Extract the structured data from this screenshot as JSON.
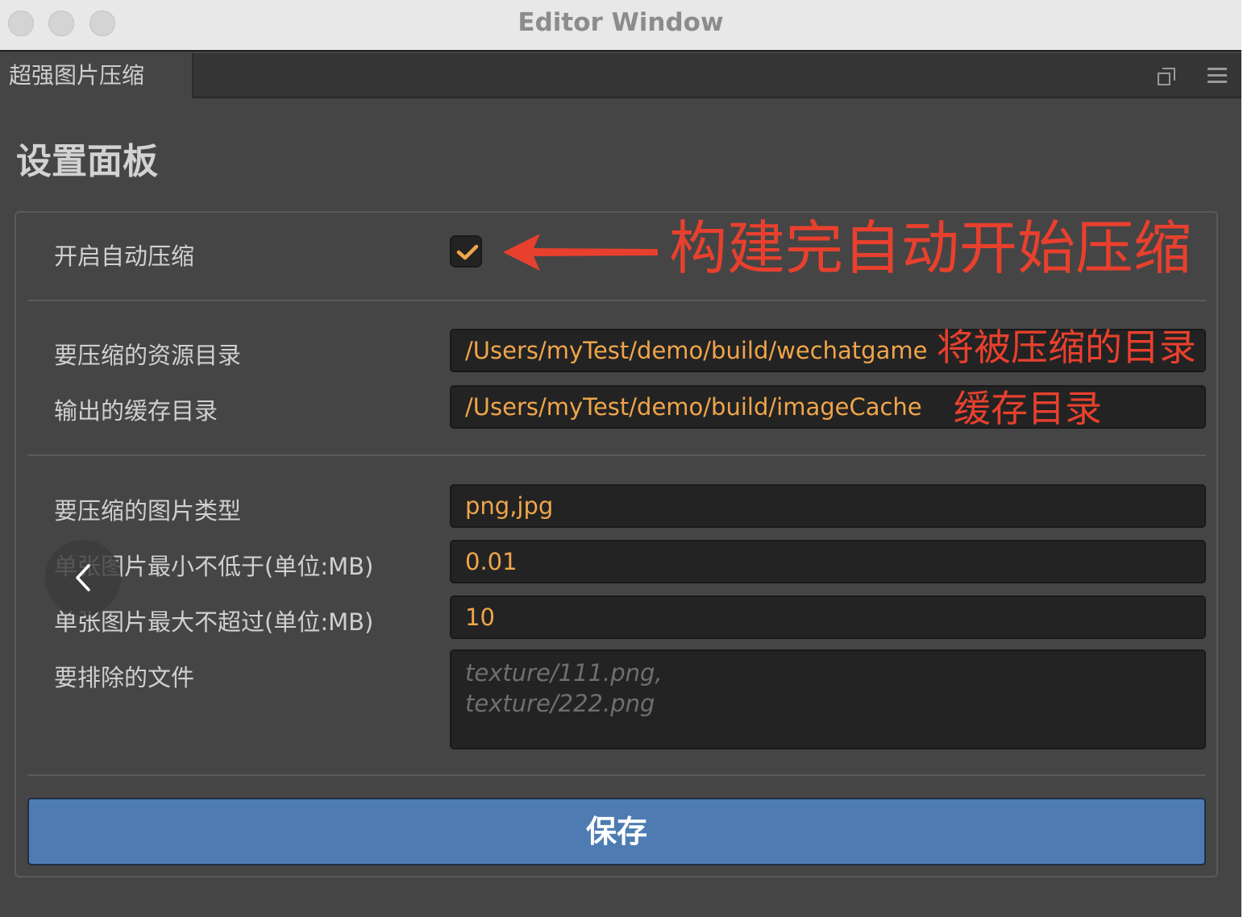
{
  "window": {
    "title": "Editor Window",
    "tab_label": "超强图片压缩"
  },
  "panel": {
    "title": "设置面板",
    "auto_compress": {
      "label": "开启自动压缩",
      "checked": true
    },
    "source_dir": {
      "label": "要压缩的资源目录",
      "value": "/Users/myTest/demo/build/wechatgame"
    },
    "cache_dir": {
      "label": "输出的缓存目录",
      "value": "/Users/myTest/demo/build/imageCache"
    },
    "image_types": {
      "label": "要压缩的图片类型",
      "value": "png,jpg"
    },
    "min_size": {
      "label": "单张图片最小不低于(单位:MB)",
      "value": "0.01"
    },
    "max_size": {
      "label": "单张图片最大不超过(单位:MB)",
      "value": "10"
    },
    "exclude_files": {
      "label": "要排除的文件",
      "placeholder": "texture/111.png,\ntexture/222.png"
    },
    "save_label": "保存"
  },
  "annotations": {
    "auto_compress_note": "构建完自动开始压缩",
    "source_dir_note": "将被压缩的目录",
    "cache_dir_note": "缓存目录",
    "color": "#e8402e"
  },
  "colors": {
    "panel_bg": "#454545",
    "field_bg": "#232323",
    "field_text": "#f0a54a",
    "button": "#4e7cb2"
  }
}
